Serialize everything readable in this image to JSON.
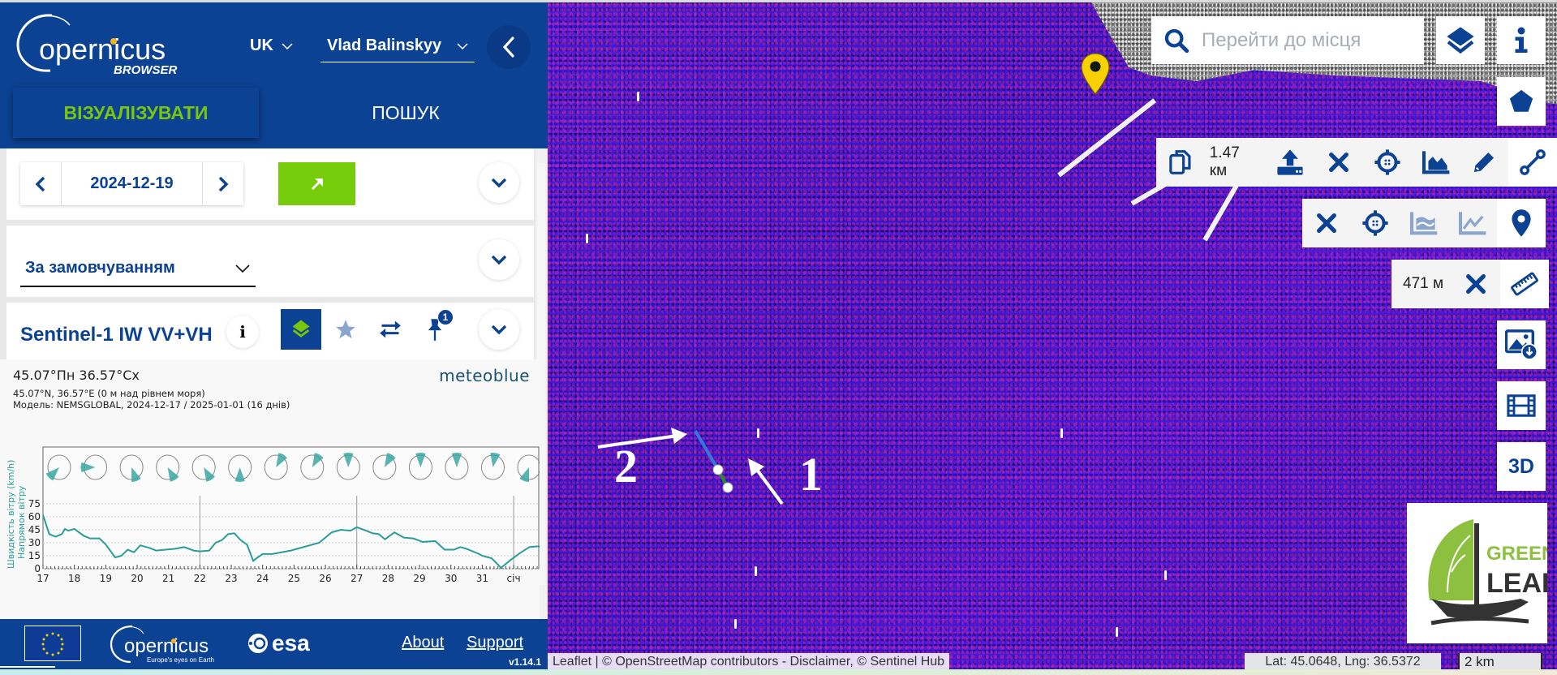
{
  "app": {
    "logo_text": "opernicus",
    "logo_sub": "BROWSER",
    "language": "UK",
    "user": "Vlad Balinskyy"
  },
  "tabs": {
    "visualize": "ВІЗУАЛІЗУВАТИ",
    "search": "ПОШУК"
  },
  "date_panel": {
    "date": "2024-12-19"
  },
  "theme_panel": {
    "selected": "За замовчуванням"
  },
  "layer_panel": {
    "title": "Sentinel-1 IW VV+VH",
    "pin_count": "1"
  },
  "meteoblue": {
    "title": "45.07°Пн 36.57°Сх",
    "line1": "45.07°N, 36.57°E (0 м над рівнем моря)",
    "line2": "Модель: NEMSGLOBAL, 2024-12-17 / 2025-01-01 (16 днів)",
    "brand": "meteoblue"
  },
  "chart_data": {
    "type": "line",
    "title": "",
    "ylabel": "Швидкість вітру (km/h)",
    "ylabel2": "Напрямок вітру",
    "xlabel": "",
    "categories": [
      "17",
      "18",
      "19",
      "20",
      "21",
      "22",
      "23",
      "24",
      "25",
      "26",
      "27",
      "28",
      "29",
      "30",
      "31",
      "січ"
    ],
    "ylim": [
      0,
      75
    ],
    "yticks": [
      0,
      15,
      30,
      45,
      60,
      75
    ],
    "grid": true,
    "series": [
      {
        "name": "Швидкість вітру (km/h)",
        "color": "#2a9d9a",
        "x": [
          0,
          0.2,
          0.4,
          0.6,
          0.7,
          0.8,
          1.0,
          1.3,
          1.5,
          1.8,
          2.0,
          2.3,
          2.5,
          2.7,
          2.9,
          3.1,
          3.4,
          3.6,
          3.9,
          4.2,
          4.5,
          4.8,
          5.0,
          5.3,
          5.5,
          5.7,
          5.9,
          6.1,
          6.3,
          6.5,
          6.7,
          6.8,
          7.0,
          7.3,
          7.6,
          7.9,
          8.2,
          8.5,
          8.8,
          9.0,
          9.2,
          9.5,
          9.8,
          10.0,
          10.3,
          10.5,
          10.7,
          10.9,
          11.2,
          11.5,
          11.8,
          12.1,
          12.5,
          12.8,
          13.1,
          13.3,
          13.5,
          13.7,
          13.9,
          14.0,
          14.3,
          14.6,
          14.9,
          15.2,
          15.5,
          15.8,
          16.0
        ],
        "values": [
          62,
          40,
          37,
          40,
          46,
          44,
          46,
          38,
          35,
          35,
          28,
          13,
          15,
          22,
          19,
          27,
          24,
          21,
          22,
          23,
          25,
          21,
          20,
          21,
          30,
          33,
          40,
          41,
          33,
          28,
          9,
          12,
          17,
          17,
          19,
          21,
          24,
          27,
          30,
          36,
          42,
          45,
          44,
          48,
          44,
          41,
          40,
          34,
          42,
          36,
          35,
          31,
          32,
          22,
          22,
          25,
          23,
          20,
          17,
          15,
          12,
          1,
          10,
          18,
          25,
          26,
          22
        ]
      }
    ],
    "wind_directions_deg": [
      225,
      270,
      160,
      150,
      150,
      180,
      30,
      30,
      0,
      30,
      0,
      0,
      10,
      200
    ],
    "legend": "none"
  },
  "map": {
    "search_placeholder": "Перейти до місця",
    "measure_distance": "1.47 км",
    "ruler_distance": "471 м",
    "three_d_label": "3D",
    "attribution_leaflet": "Leaflet",
    "attribution_rest": "| © OpenStreetMap contributors - Disclaimer, © Sentinel Hub",
    "coords": "Lat: 45.0648, Lng: 36.5372",
    "scale": "2 km",
    "annotation_1": "1",
    "annotation_2": "2",
    "greenleaf_top": "GREEN",
    "greenleaf_bottom": "LEAF"
  },
  "footer": {
    "about": "About",
    "support": "Support",
    "version": "v1.14.1",
    "copernicus_tagline": "Europe's eyes on Earth",
    "esa": "esa"
  },
  "colors": {
    "brand_blue": "#0c4293",
    "accent_green": "#76cb0b",
    "chart_teal": "#2a9d9a"
  }
}
